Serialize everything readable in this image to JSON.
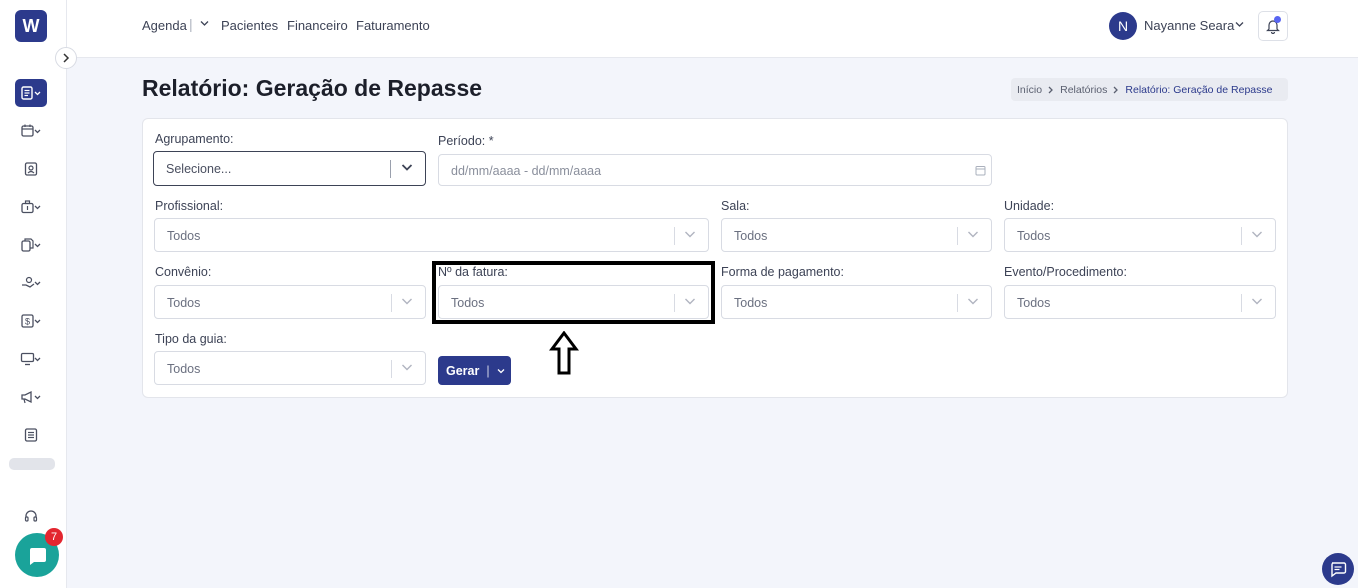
{
  "app": {
    "logo_letter": "W"
  },
  "topnav": {
    "items": [
      "Agenda",
      "Pacientes",
      "Financeiro",
      "Faturamento"
    ],
    "separator": "|",
    "user": {
      "initial": "N",
      "name": "Nayanne Seara"
    }
  },
  "page": {
    "title": "Relatório: Geração de Repasse",
    "breadcrumb": [
      "Início",
      "Relatórios",
      "Relatório: Geração de Repasse"
    ]
  },
  "form": {
    "agrupamento": {
      "label": "Agrupamento:",
      "placeholder": "Selecione..."
    },
    "periodo": {
      "label": "Período: *",
      "placeholder": "dd/mm/aaaa - dd/mm/aaaa"
    },
    "profissional": {
      "label": "Profissional:",
      "value": "Todos"
    },
    "sala": {
      "label": "Sala:",
      "value": "Todos"
    },
    "unidade": {
      "label": "Unidade:",
      "value": "Todos"
    },
    "convenio": {
      "label": "Convênio:",
      "value": "Todos"
    },
    "fatura": {
      "label": "Nº da fatura:",
      "value": "Todos"
    },
    "pagamento": {
      "label": "Forma de pagamento:",
      "value": "Todos"
    },
    "evento": {
      "label": "Evento/Procedimento:",
      "value": "Todos"
    },
    "guia": {
      "label": "Tipo da guia:",
      "value": "Todos"
    },
    "gerar_button": {
      "label": "Gerar",
      "separator": "|"
    }
  },
  "chat": {
    "badge_count": "7"
  },
  "icons": {
    "sidebar": [
      "report-icon",
      "calendar-icon",
      "patient-badge-icon",
      "briefcase-icon",
      "documents-icon",
      "hand-coins-icon",
      "dollar-icon",
      "monitor-icon",
      "megaphone-icon",
      "newspaper-icon",
      "headset-icon"
    ]
  },
  "colors": {
    "primary": "#2c3a8c",
    "chat": "#1aa39a",
    "badge": "#e3262f"
  }
}
